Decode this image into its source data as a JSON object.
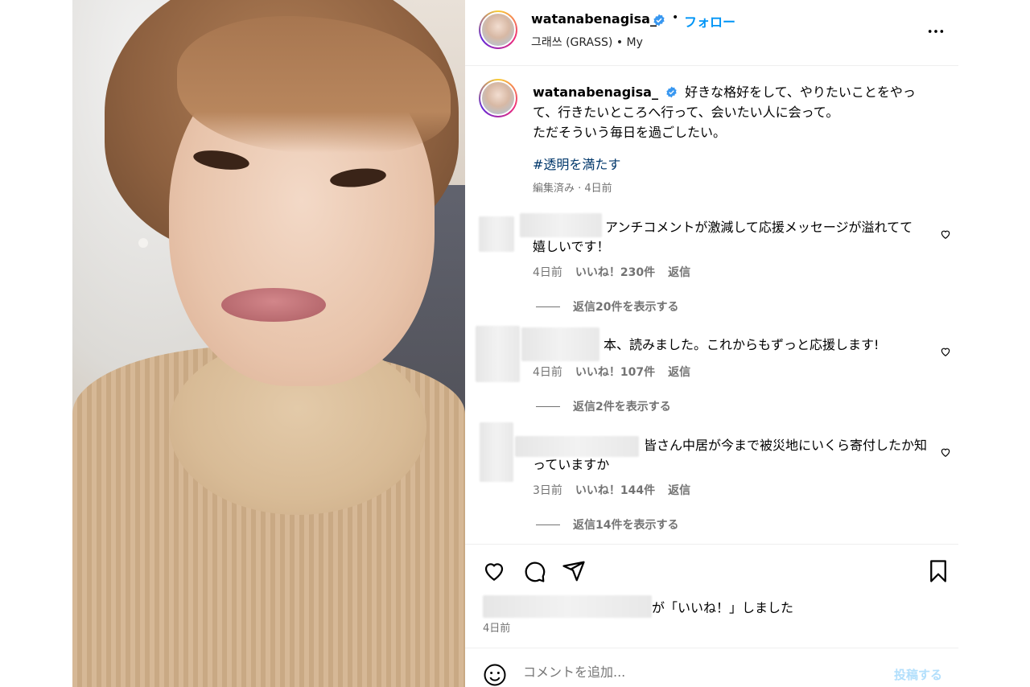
{
  "post": {
    "username": "watanabenagisa_",
    "follow_label": "フォロー",
    "dot": "•",
    "subtitle": "그래쓰 (GRASS) • My",
    "caption_line1": "好きな格好をして、やりたいことをやって、行きたいところへ行って、会いたい人に会って。",
    "caption_line2": "ただそういう毎日を過ごしたい。",
    "hashtag": "#透明を満たす",
    "caption_meta": "編集済み · 4日前"
  },
  "comments": [
    {
      "text": "アンチコメントが激減して応援メッセージが溢れてて嬉しいです！",
      "time": "4日前",
      "likes": "いいね！230件",
      "reply": "返信",
      "view_replies": "返信20件を表示する"
    },
    {
      "text": "本、読みました。これからもずっと応援します!",
      "time": "4日前",
      "likes": "いいね！107件",
      "reply": "返信",
      "view_replies": "返信2件を表示する"
    },
    {
      "text": "皆さん中居が今まで被災地にいくら寄付したか知っていますか",
      "time": "3日前",
      "likes": "いいね！144件",
      "reply": "返信",
      "view_replies": "返信14件を表示する"
    }
  ],
  "footer": {
    "liked_by_suffix": "が「いいね！」しました",
    "post_time": "4日前",
    "comment_placeholder": "コメントを追加...",
    "post_button": "投稿する"
  },
  "icons": {
    "verified": "verified-badge-icon",
    "more": "more-options-icon",
    "heart": "heart-icon",
    "comment": "comment-icon",
    "share": "share-icon",
    "save": "bookmark-icon",
    "emoji": "emoji-icon",
    "mute": "muted-audio-icon"
  },
  "colors": {
    "follow": "#0095f6",
    "hashtag": "#00376b",
    "muted_text": "#737373",
    "post_button_disabled": "#b2dffc",
    "verified": "#3897f0"
  }
}
